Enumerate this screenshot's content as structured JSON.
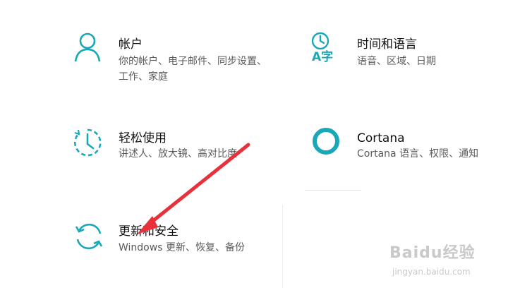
{
  "settings_tiles": [
    {
      "title": "帐户",
      "description": "你的帐户、电子邮件、同步设置、工作、家庭",
      "icon": "person-icon"
    },
    {
      "title": "时间和语言",
      "description": "语音、区域、日期",
      "icon": "time-language-icon"
    },
    {
      "title": "轻松使用",
      "description": "讲述人、放大镜、高对比度",
      "icon": "ease-of-access-icon"
    },
    {
      "title": "Cortana",
      "description": "Cortana 语言、权限、通知",
      "icon": "cortana-icon"
    },
    {
      "title": "更新和安全",
      "description": "Windows 更新、恢复、备份",
      "icon": "update-sync-icon"
    }
  ],
  "icon_labels": {
    "time_language_glyph": "A字"
  },
  "annotation": {
    "arrow_color": "#e8313b",
    "points_to": "更新和安全"
  },
  "watermark": {
    "logo": "Baidu经验",
    "url": "jingyan.baidu.com"
  },
  "colors": {
    "accent": "#1aa8b8",
    "title": "#111111",
    "description": "#5a5a5a",
    "background": "#ffffff"
  }
}
